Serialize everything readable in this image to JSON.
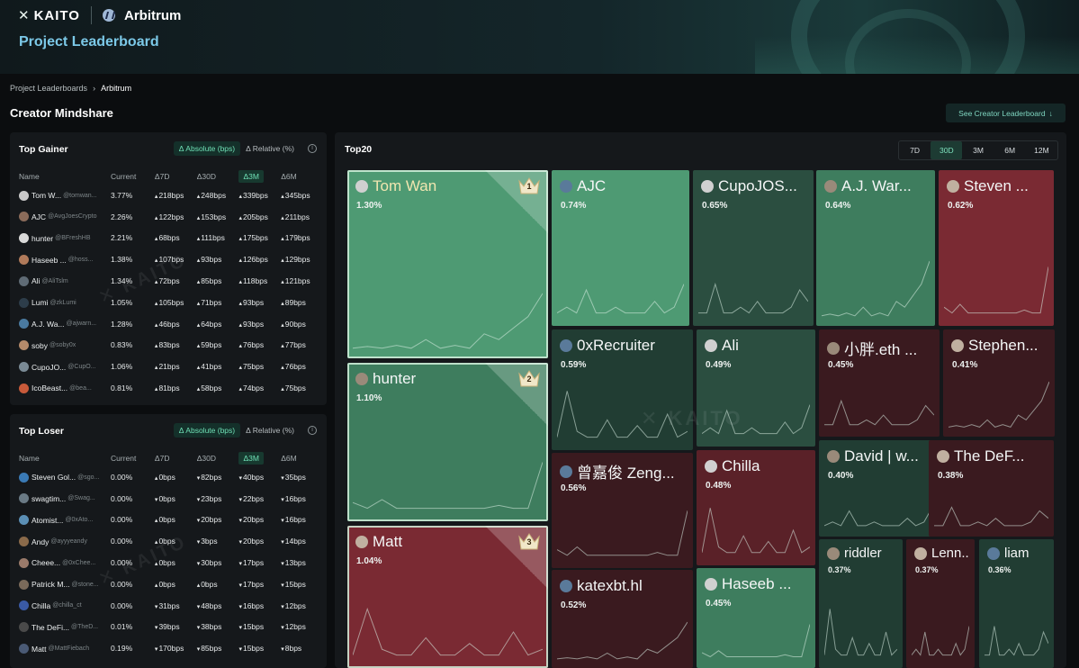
{
  "header": {
    "brand": "KAITO",
    "project": "Arbitrum",
    "title": "Project Leaderboard"
  },
  "breadcrumb": {
    "parent": "Project Leaderboards",
    "current": "Arbitrum"
  },
  "section_title": "Creator Mindshare",
  "see_creator_label": "See Creator Leaderboard",
  "toggle": {
    "absolute": "Δ Absolute (bps)",
    "relative": "Δ Relative (%)"
  },
  "columns": [
    "Name",
    "Current",
    "Δ7D",
    "Δ30D",
    "Δ3M",
    "Δ6M"
  ],
  "gainer": {
    "title": "Top Gainer",
    "rows": [
      {
        "name": "Tom W...",
        "handle": "@tomwan...",
        "current": "3.77%",
        "d7": "218bps",
        "d30": "248bps",
        "d3m": "339bps",
        "d6m": "345bps",
        "color": "#c9c9c9"
      },
      {
        "name": "AJC",
        "handle": "@AvgJoesCrypto",
        "current": "2.26%",
        "d7": "122bps",
        "d30": "153bps",
        "d3m": "205bps",
        "d6m": "211bps",
        "color": "#8a6b5a"
      },
      {
        "name": "hunter",
        "handle": "@BFreshHB",
        "current": "2.21%",
        "d7": "68bps",
        "d30": "111bps",
        "d3m": "175bps",
        "d6m": "179bps",
        "color": "#d9d9d9"
      },
      {
        "name": "Haseeb ...",
        "handle": "@hoss...",
        "current": "1.38%",
        "d7": "107bps",
        "d30": "93bps",
        "d3m": "126bps",
        "d6m": "129bps",
        "color": "#b07a5a"
      },
      {
        "name": "Ali",
        "handle": "@AliTslm",
        "current": "1.34%",
        "d7": "72bps",
        "d30": "85bps",
        "d3m": "118bps",
        "d6m": "121bps",
        "color": "#5f6b75"
      },
      {
        "name": "Lumi",
        "handle": "@zkLumi",
        "current": "1.05%",
        "d7": "105bps",
        "d30": "71bps",
        "d3m": "93bps",
        "d6m": "89bps",
        "color": "#2d3d4a"
      },
      {
        "name": "A.J. Wa...",
        "handle": "@ajwarn...",
        "current": "1.28%",
        "d7": "46bps",
        "d30": "64bps",
        "d3m": "93bps",
        "d6m": "90bps",
        "color": "#4a7aa0"
      },
      {
        "name": "soby",
        "handle": "@soby0x",
        "current": "0.83%",
        "d7": "83bps",
        "d30": "59bps",
        "d3m": "76bps",
        "d6m": "77bps",
        "color": "#b58a6a"
      },
      {
        "name": "CupoJO...",
        "handle": "@CupO...",
        "current": "1.06%",
        "d7": "21bps",
        "d30": "41bps",
        "d3m": "75bps",
        "d6m": "76bps",
        "color": "#7a8a95"
      },
      {
        "name": "IcoBeast...",
        "handle": "@bea...",
        "current": "0.81%",
        "d7": "81bps",
        "d30": "58bps",
        "d3m": "74bps",
        "d6m": "75bps",
        "color": "#c85a3a"
      }
    ]
  },
  "loser": {
    "title": "Top Loser",
    "rows": [
      {
        "name": "Steven Gol...",
        "handle": "@sgo...",
        "current": "0.00%",
        "d7": "0bps",
        "d30": "82bps",
        "d3m": "40bps",
        "d6m": "35bps",
        "d7dir": "flat",
        "color": "#3a7ab5"
      },
      {
        "name": "swagtim...",
        "handle": "@Swag...",
        "current": "0.00%",
        "d7": "0bps",
        "d30": "23bps",
        "d3m": "22bps",
        "d6m": "16bps",
        "d7dir": "dn",
        "color": "#6a7a85"
      },
      {
        "name": "Atomist...",
        "handle": "@0xAto...",
        "current": "0.00%",
        "d7": "0bps",
        "d30": "20bps",
        "d3m": "20bps",
        "d6m": "16bps",
        "d7dir": "flat",
        "color": "#5b8fb5"
      },
      {
        "name": "Andy",
        "handle": "@ayyyeandy",
        "current": "0.00%",
        "d7": "0bps",
        "d30": "3bps",
        "d3m": "20bps",
        "d6m": "14bps",
        "d7dir": "flat",
        "color": "#8a6a4a"
      },
      {
        "name": "Cheee...",
        "handle": "@0xChee...",
        "current": "0.00%",
        "d7": "0bps",
        "d30": "30bps",
        "d3m": "17bps",
        "d6m": "13bps",
        "d7dir": "up",
        "color": "#9a7a6a"
      },
      {
        "name": "Patrick M...",
        "handle": "@stone...",
        "current": "0.00%",
        "d7": "0bps",
        "d30": "0bps",
        "d3m": "17bps",
        "d6m": "15bps",
        "d7dir": "flat",
        "d30dir": "flat",
        "color": "#7a6a5a"
      },
      {
        "name": "Chilla",
        "handle": "@chilla_ct",
        "current": "0.00%",
        "d7": "31bps",
        "d30": "48bps",
        "d3m": "16bps",
        "d6m": "12bps",
        "d7dir": "dn",
        "color": "#3a5aa5"
      },
      {
        "name": "The DeFi...",
        "handle": "@TheD...",
        "current": "0.01%",
        "d7": "39bps",
        "d30": "38bps",
        "d3m": "15bps",
        "d6m": "12bps",
        "d7dir": "dn",
        "color": "#4a4a4a"
      },
      {
        "name": "Matt",
        "handle": "@MattFiebach",
        "current": "0.19%",
        "d7": "170bps",
        "d30": "85bps",
        "d3m": "15bps",
        "d6m": "8bps",
        "d7dir": "dn",
        "color": "#4a5a75"
      }
    ]
  },
  "top20": {
    "title": "Top20",
    "ranges": [
      "7D",
      "30D",
      "3M",
      "6M",
      "12M"
    ],
    "active_range": "30D",
    "tiles": [
      {
        "name": "Tom Wan",
        "pct": "1.30%",
        "rank": "1",
        "tone": "g1"
      },
      {
        "name": "hunter",
        "pct": "1.10%",
        "rank": "2",
        "tone": "g2"
      },
      {
        "name": "Matt",
        "pct": "1.04%",
        "rank": "3",
        "tone": "r1"
      },
      {
        "name": "AJC",
        "pct": "0.74%",
        "tone": "g1"
      },
      {
        "name": "CupoJOS...",
        "pct": "0.65%",
        "tone": "g3"
      },
      {
        "name": "A.J. War...",
        "pct": "0.64%",
        "tone": "g2"
      },
      {
        "name": "Steven ...",
        "pct": "0.62%",
        "tone": "r1"
      },
      {
        "name": "0xRecruiter",
        "pct": "0.59%",
        "tone": "g4"
      },
      {
        "name": "Ali",
        "pct": "0.49%",
        "tone": "g3"
      },
      {
        "name": "小胖.eth ...",
        "pct": "0.45%",
        "tone": "r3"
      },
      {
        "name": "Stephen...",
        "pct": "0.41%",
        "tone": "r3"
      },
      {
        "name": "曾嘉俊 Zeng...",
        "pct": "0.56%",
        "tone": "r3"
      },
      {
        "name": "Chilla",
        "pct": "0.48%",
        "tone": "r2"
      },
      {
        "name": "David | w...",
        "pct": "0.40%",
        "tone": "g4"
      },
      {
        "name": "The DeF...",
        "pct": "0.38%",
        "tone": "r3"
      },
      {
        "name": "katexbt.hl",
        "pct": "0.52%",
        "tone": "r3"
      },
      {
        "name": "Haseeb ...",
        "pct": "0.45%",
        "tone": "g2"
      },
      {
        "name": "riddler",
        "pct": "0.37%",
        "tone": "g4"
      },
      {
        "name": "Lenn...",
        "pct": "0.37%",
        "tone": "r3"
      },
      {
        "name": "liam",
        "pct": "0.36%",
        "tone": "g4"
      }
    ]
  },
  "colors": {
    "g1": "#4e9a73",
    "g2": "#3e7d5e",
    "g3": "#2b4e40",
    "g4": "#213d33",
    "r1": "#7a2a33",
    "r2": "#5a2128",
    "r3": "#3a1a1f",
    "up": "#6be0b0",
    "down": "#ef5c6c"
  }
}
